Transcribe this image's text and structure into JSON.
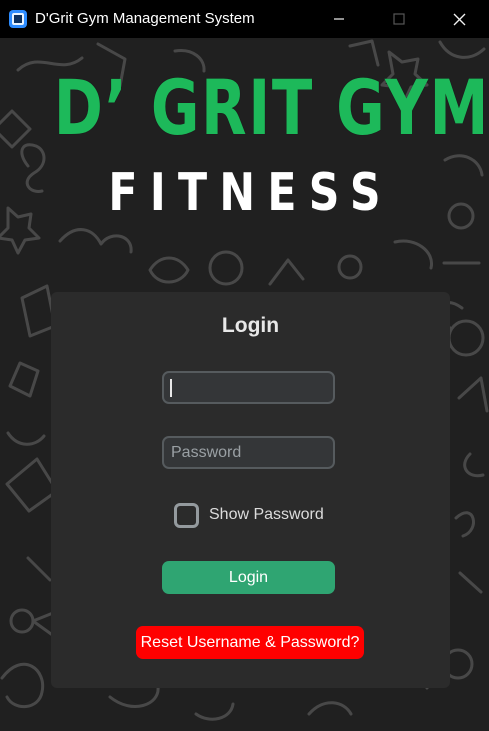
{
  "window": {
    "title": "D'Grit Gym Management System",
    "app_icon": "app-window-icon",
    "controls": {
      "minimize_icon": "minimize-icon",
      "maximize_icon": "maximize-icon",
      "close_icon": "close-icon"
    }
  },
  "brand": {
    "title": "D’ GRIT GYM",
    "subtitle": "FITNESS",
    "title_color": "#1db95a",
    "subtitle_color": "#ffffff"
  },
  "login": {
    "heading": "Login",
    "username": {
      "value": "",
      "placeholder": ""
    },
    "password": {
      "value": "",
      "placeholder": "Password"
    },
    "show_password": {
      "label": "Show Password",
      "checked": false
    },
    "login_button": "Login",
    "reset_button": "Reset Username & Password?"
  },
  "colors": {
    "card_background": "#2b2b2b",
    "login_button": "#2fa572",
    "reset_button": "#ff0000"
  }
}
